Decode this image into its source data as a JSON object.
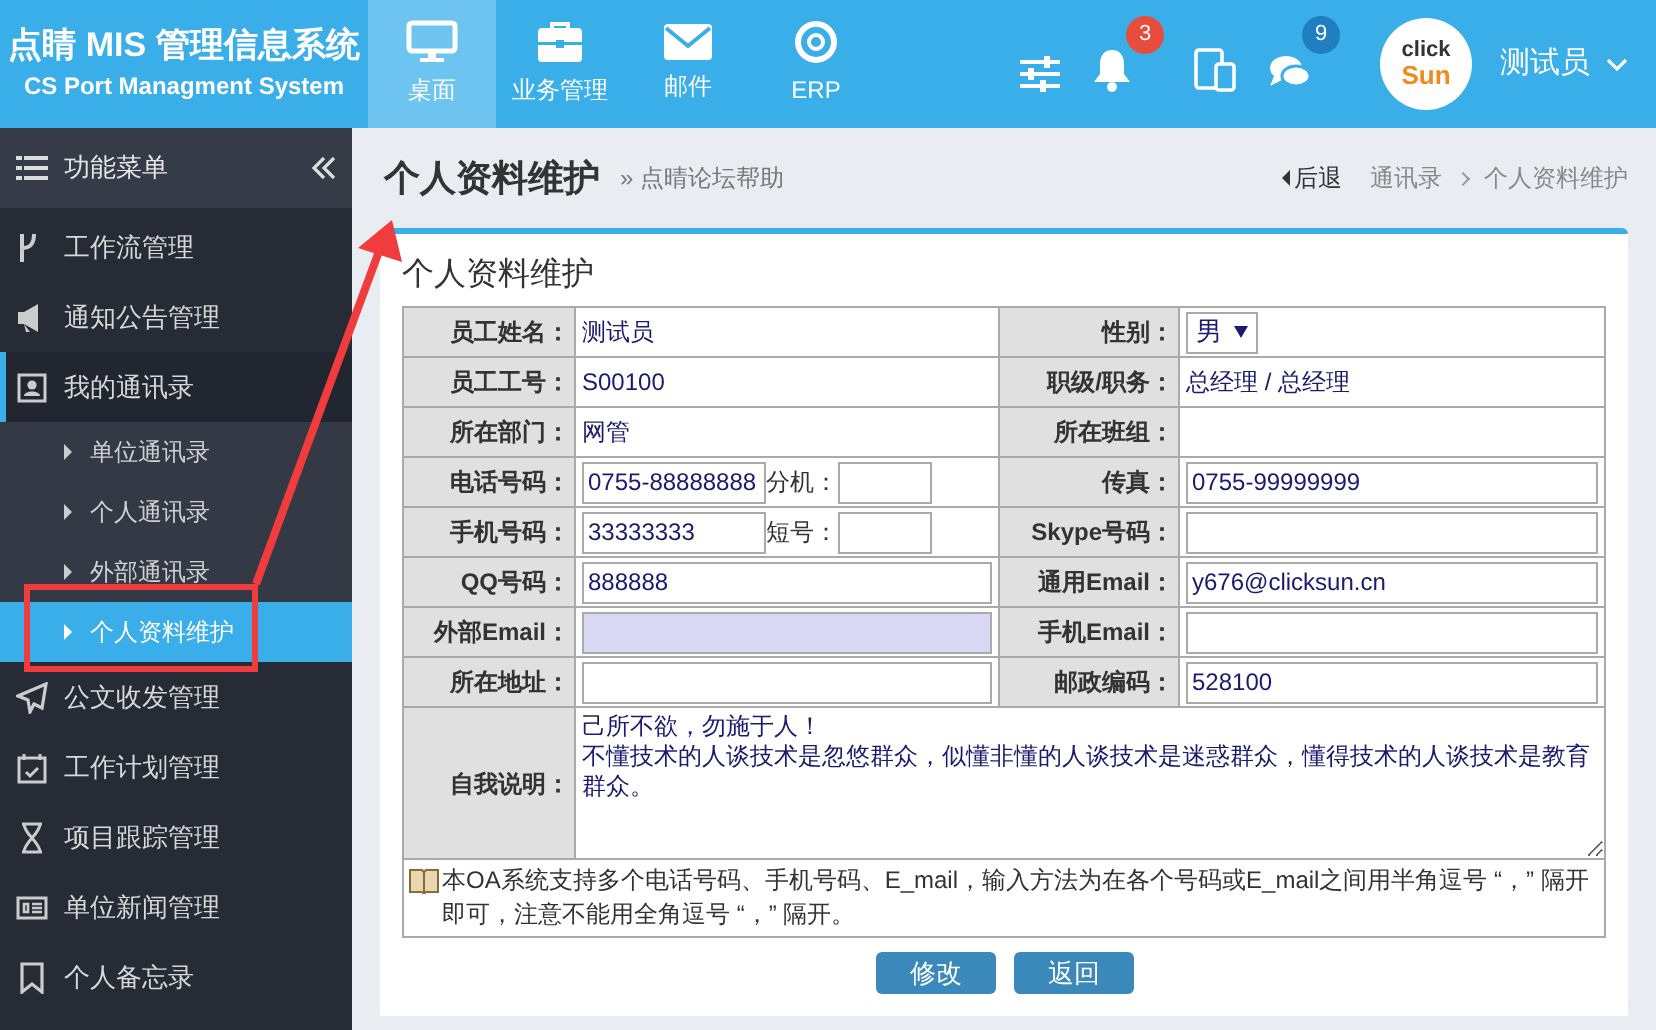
{
  "header": {
    "title": "点睛 MIS 管理信息系统",
    "subtitle": "CS Port Managment System",
    "nav": [
      {
        "label": "桌面",
        "selected": true
      },
      {
        "label": "业务管理",
        "selected": false
      },
      {
        "label": "邮件",
        "selected": false
      },
      {
        "label": "ERP",
        "selected": false
      }
    ],
    "alerts": {
      "badge": "3",
      "color": "#e74c3c"
    },
    "messages": {
      "badge": "9",
      "color": "#1f7fc0"
    },
    "logo": {
      "line_1": "click",
      "line_2": "Sun"
    },
    "user": "测试员"
  },
  "sidebar": {
    "title": "功能菜单",
    "items": [
      {
        "label": "工作流管理",
        "expanded": false
      },
      {
        "label": "通知公告管理",
        "expanded": false
      },
      {
        "label": "我的通讯录",
        "expanded": true,
        "children": [
          {
            "label": "单位通讯录",
            "selected": false
          },
          {
            "label": "个人通讯录",
            "selected": false
          },
          {
            "label": "外部通讯录",
            "selected": false
          },
          {
            "label": "个人资料维护",
            "selected": true
          }
        ]
      },
      {
        "label": "公文收发管理",
        "expanded": false
      },
      {
        "label": "工作计划管理",
        "expanded": false
      },
      {
        "label": "项目跟踪管理",
        "expanded": false
      },
      {
        "label": "单位新闻管理",
        "expanded": false
      },
      {
        "label": "个人备忘录",
        "expanded": false
      }
    ]
  },
  "page": {
    "title": "个人资料维护",
    "help_link": "» 点晴论坛帮助",
    "back": "后退",
    "breadcrumb": [
      "通讯录",
      "个人资料维护"
    ]
  },
  "form": {
    "title": "个人资料维护",
    "rows": [
      [
        {
          "label": "员工姓名：",
          "kind": "text",
          "value": "测试员"
        },
        {
          "label": "性别：",
          "kind": "select",
          "value": "男"
        }
      ],
      [
        {
          "label": "员工工号：",
          "kind": "text",
          "value": "S00100"
        },
        {
          "label": "职级/职务：",
          "kind": "text",
          "value": "总经理 / 总经理"
        }
      ],
      [
        {
          "label": "所在部门：",
          "kind": "text",
          "value": "网管"
        },
        {
          "label": "所在班组：",
          "kind": "text"
        }
      ],
      [
        {
          "label": "电话号码：",
          "kind": "pair",
          "value": "0755-88888888",
          "sub_label": "分机："
        },
        {
          "label": "传真：",
          "kind": "input",
          "value": "0755-99999999",
          "highlighted": false
        }
      ],
      [
        {
          "label": "手机号码：",
          "kind": "pair",
          "value": "33333333",
          "sub_label": "短号："
        },
        {
          "label": "Skype号码：",
          "kind": "input",
          "highlighted": false
        }
      ],
      [
        {
          "label": "QQ号码：",
          "kind": "input",
          "value": "888888",
          "highlighted": false
        },
        {
          "label": "通用Email：",
          "kind": "input",
          "value": "y676@clicksun.cn",
          "highlighted": false
        }
      ],
      [
        {
          "label": "外部Email：",
          "kind": "input",
          "highlighted": true
        },
        {
          "label": "手机Email：",
          "kind": "input",
          "highlighted": false
        }
      ],
      [
        {
          "label": "所在地址：",
          "kind": "input",
          "highlighted": false
        },
        {
          "label": "邮政编码：",
          "kind": "input",
          "value": "528100",
          "highlighted": false
        }
      ]
    ],
    "about": {
      "label": "自我说明：",
      "lines": [
        "己所不欲，勿施于人！",
        "不懂技术的人谈技术是忽悠群众，似懂非懂的人谈技术是迷惑群众，懂得技术的人谈技术是教育群众。"
      ]
    },
    "note": "本OA系统支持多个电话号码、手机号码、E_mail，输入方法为在各个号码或E_mail之间用半角逗号 “，” 隔开即可，注意不能用全角逗号 “，” 隔开。",
    "buttons": [
      "修改",
      "返回"
    ]
  }
}
